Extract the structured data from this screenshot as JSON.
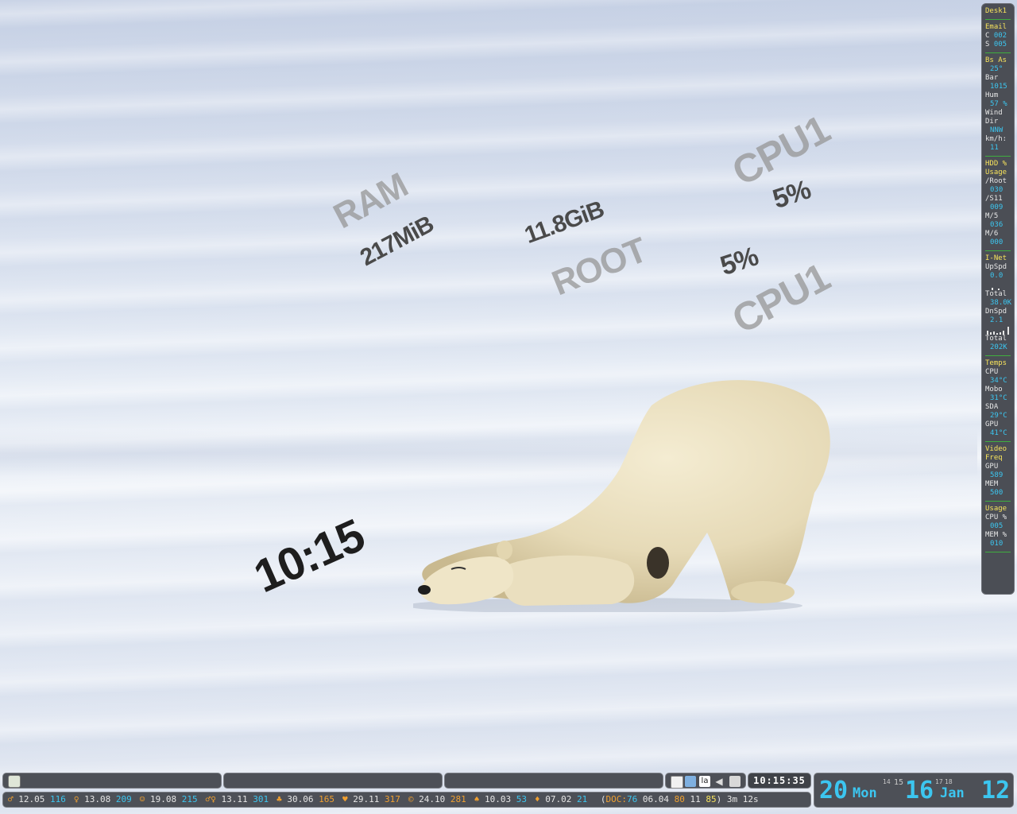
{
  "desktop": {
    "overlays": {
      "ram_label": "RAM",
      "ram_value": "217MiB",
      "root_value": "11.8GiB",
      "root_label": "ROOT",
      "cpu_top_label": "CPU1",
      "cpu_top_value": "5%",
      "cpu_bottom_value": "5%",
      "cpu_bottom_label": "CPU1",
      "clock": "10:15"
    }
  },
  "panel": {
    "desk": "Desk1",
    "email": {
      "title": "Email",
      "c_label": "C",
      "c_value": "002",
      "s_label": "S",
      "s_value": "005"
    },
    "weather": {
      "title": "Bs As",
      "temp": "25°",
      "bar_label": "Bar",
      "bar_value": "1015",
      "hum_label": "Hum",
      "hum_value": "57 %",
      "wind_label": "Wind",
      "dir_label": "Dir",
      "dir_value": "NNW",
      "speed_label": "km/h:",
      "speed_value": "11"
    },
    "hdd": {
      "title1": "HDD %",
      "title2": "Usage",
      "root_label": "/Root",
      "root_value": "030",
      "s11_label": "/S11",
      "s11_value": "009",
      "m5_label": "M/5",
      "m5_value": "036",
      "m6_label": "M/6",
      "m6_value": "000"
    },
    "net": {
      "title": "I-Net",
      "up_label": "UpSpd",
      "up_value": "0.0",
      "total_up_label": "Total",
      "total_up_value": "38.0K",
      "down_label": "DnSpd",
      "down_value": "2.1",
      "total_down_label": "Total",
      "total_down_value": "202K"
    },
    "temps": {
      "title": "Temps",
      "cpu_label": "CPU",
      "cpu_value": "34°C",
      "mobo_label": "Mobo",
      "mobo_value": "31°C",
      "sda_label": "SDA",
      "sda_value": "29°C",
      "gpu_label": "GPU",
      "gpu_value": "41°C"
    },
    "video": {
      "title1": "Video",
      "title2": "Freq",
      "gpu_label": "GPU",
      "gpu_value": "589",
      "mem_label": "MEM",
      "mem_value": "500"
    },
    "usage": {
      "title": "Usage",
      "cpu_label": "CPU %",
      "cpu_value": "005",
      "mem_label": "MEM %",
      "mem_value": "010"
    }
  },
  "taskbar": {
    "clock": "10:15:35",
    "tray_text": "la",
    "colors": {
      "panel": "#4d5057",
      "cyan": "#3cc6f0",
      "yellow": "#f7e35c",
      "orange": "#f0a030"
    }
  },
  "astro": [
    {
      "sym": "♂",
      "time": "12.05",
      "num": "116",
      "num_color": "blue"
    },
    {
      "sym": "♀",
      "time": "13.08",
      "num": "209",
      "num_color": "blue"
    },
    {
      "sym": "☺",
      "time": "19.08",
      "num": "215",
      "num_color": "blue"
    },
    {
      "sym": "♂♀",
      "time": "13.11",
      "num": "301",
      "num_color": "blue"
    },
    {
      "sym": "♣",
      "time": "30.06",
      "num": "165",
      "num_color": "orange"
    },
    {
      "sym": "♥",
      "time": "29.11",
      "num": "317",
      "num_color": "orange"
    },
    {
      "sym": "©",
      "time": "24.10",
      "num": "281",
      "num_color": "orange"
    },
    {
      "sym": "♠",
      "time": "10.03",
      "num": "53",
      "num_color": "blue"
    },
    {
      "sym": "♦",
      "time": "07.02",
      "num": "21",
      "num_color": "blue"
    }
  ],
  "doc_info": {
    "open": "(",
    "doc_label": "DOC:",
    "doc_value": "76",
    "date": "06.04",
    "v1": "80",
    "v2": "11",
    "v3": "85",
    "close": ")",
    "uptime": "3m 12s"
  },
  "datebox": {
    "hour": "20",
    "weekday": "Mon",
    "small1": "14",
    "small2": "15",
    "day": "16",
    "small3": "17",
    "small4": "18",
    "month": "Jan",
    "month_num": "12"
  }
}
